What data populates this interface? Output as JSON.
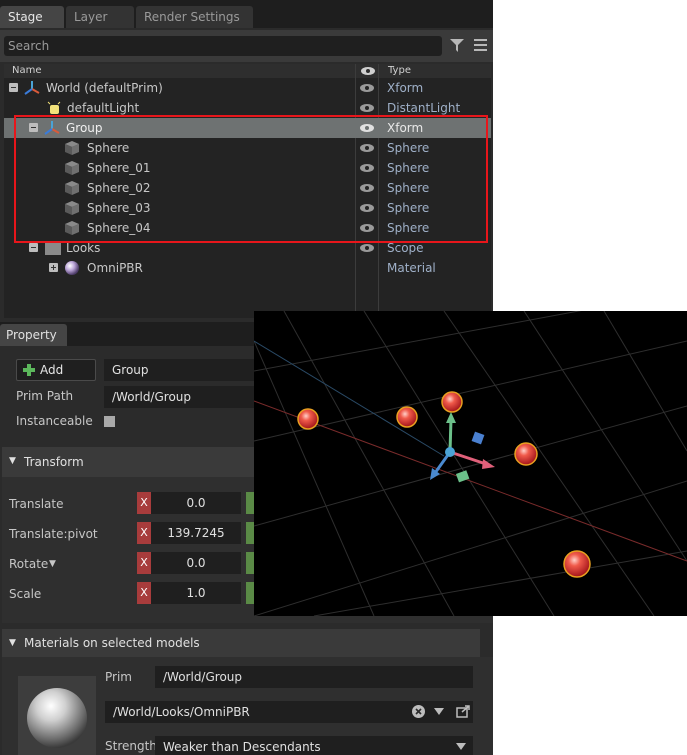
{
  "tabs": [
    {
      "label": "Stage",
      "active": true
    },
    {
      "label": "Layer",
      "active": false
    },
    {
      "label": "Render Settings",
      "active": false
    }
  ],
  "search": {
    "placeholder": "Search"
  },
  "tree_header": {
    "name": "Name",
    "type": "Type"
  },
  "tree_rows": [
    {
      "name": "World (defaultPrim)",
      "type": "Xform",
      "icon": "xform-axis-icon"
    },
    {
      "name": "defaultLight",
      "type": "DistantLight",
      "icon": "light-icon"
    },
    {
      "name": "Group",
      "type": "Xform",
      "icon": "xform-axis-icon",
      "selected": true
    },
    {
      "name": "Sphere",
      "type": "Sphere",
      "icon": "cube-icon"
    },
    {
      "name": "Sphere_01",
      "type": "Sphere",
      "icon": "cube-icon"
    },
    {
      "name": "Sphere_02",
      "type": "Sphere",
      "icon": "cube-icon"
    },
    {
      "name": "Sphere_03",
      "type": "Sphere",
      "icon": "cube-icon"
    },
    {
      "name": "Sphere_04",
      "type": "Sphere",
      "icon": "cube-icon"
    },
    {
      "name": "Looks",
      "type": "Scope",
      "icon": "folder-icon"
    },
    {
      "name": "OmniPBR",
      "type": "Material",
      "icon": "material-sphere-icon"
    }
  ],
  "property": {
    "tab": "Property",
    "add_label": "Add",
    "name_value": "Group",
    "prim_path_label": "Prim Path",
    "prim_path_value": "/World/Group",
    "instanceable_label": "Instanceable",
    "transform_title": "Transform",
    "translate_label": "Translate",
    "translate_x": "0.0",
    "pivot_label": "Translate:pivot",
    "pivot_x": "139.7245",
    "rotate_label": "Rotate",
    "rotate_x": "0.0",
    "scale_label": "Scale",
    "scale_x": "1.0",
    "x_letter": "X",
    "materials_title": "Materials on selected models",
    "prim_label": "Prim",
    "prim_value": "/World/Group",
    "material_value": "/World/Looks/OmniPBR",
    "strength_label": "Strength",
    "strength_value": "Weaker than Descendants"
  },
  "colors": {
    "selection": "#6e7272",
    "highlight_box": "#e8161b",
    "x_axis": "#a83c3c"
  }
}
